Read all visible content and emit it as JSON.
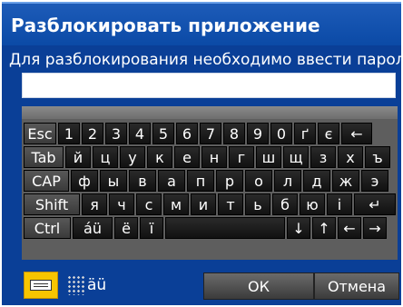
{
  "dialog": {
    "title": "Разблокировать приложение",
    "prompt": "Для разблокирования необходимо ввести пароль.",
    "password_value": ""
  },
  "keyboard": {
    "row1": [
      "Esc",
      "1",
      "2",
      "3",
      "4",
      "5",
      "6",
      "7",
      "8",
      "9",
      "0",
      "ґ",
      "є",
      "←"
    ],
    "row2": [
      "Tab",
      "й",
      "ц",
      "у",
      "к",
      "е",
      "н",
      "г",
      "ш",
      "щ",
      "з",
      "х",
      "ъ"
    ],
    "row3": [
      "CAP",
      "ф",
      "ы",
      "в",
      "а",
      "п",
      "р",
      "о",
      "л",
      "д",
      "ж",
      "э"
    ],
    "row4": [
      "Shift",
      "я",
      "ч",
      "с",
      "м",
      "и",
      "т",
      "ь",
      "б",
      "ю",
      "і",
      "↵"
    ],
    "row5": [
      "Ctrl",
      "áü",
      "ë",
      "ï",
      "",
      "↓",
      "↑",
      "←",
      "→"
    ]
  },
  "footer": {
    "layout_label": "äü",
    "ok_label": "ОК",
    "cancel_label": "Отмена"
  },
  "colors": {
    "title_bar": "#0b4aa6",
    "body": "#0a3f97",
    "accent_toggle": "#f7c500"
  },
  "icons": {
    "keyboard_toggle": "keyboard-icon",
    "layout_switch": "keypad-grid-icon"
  }
}
